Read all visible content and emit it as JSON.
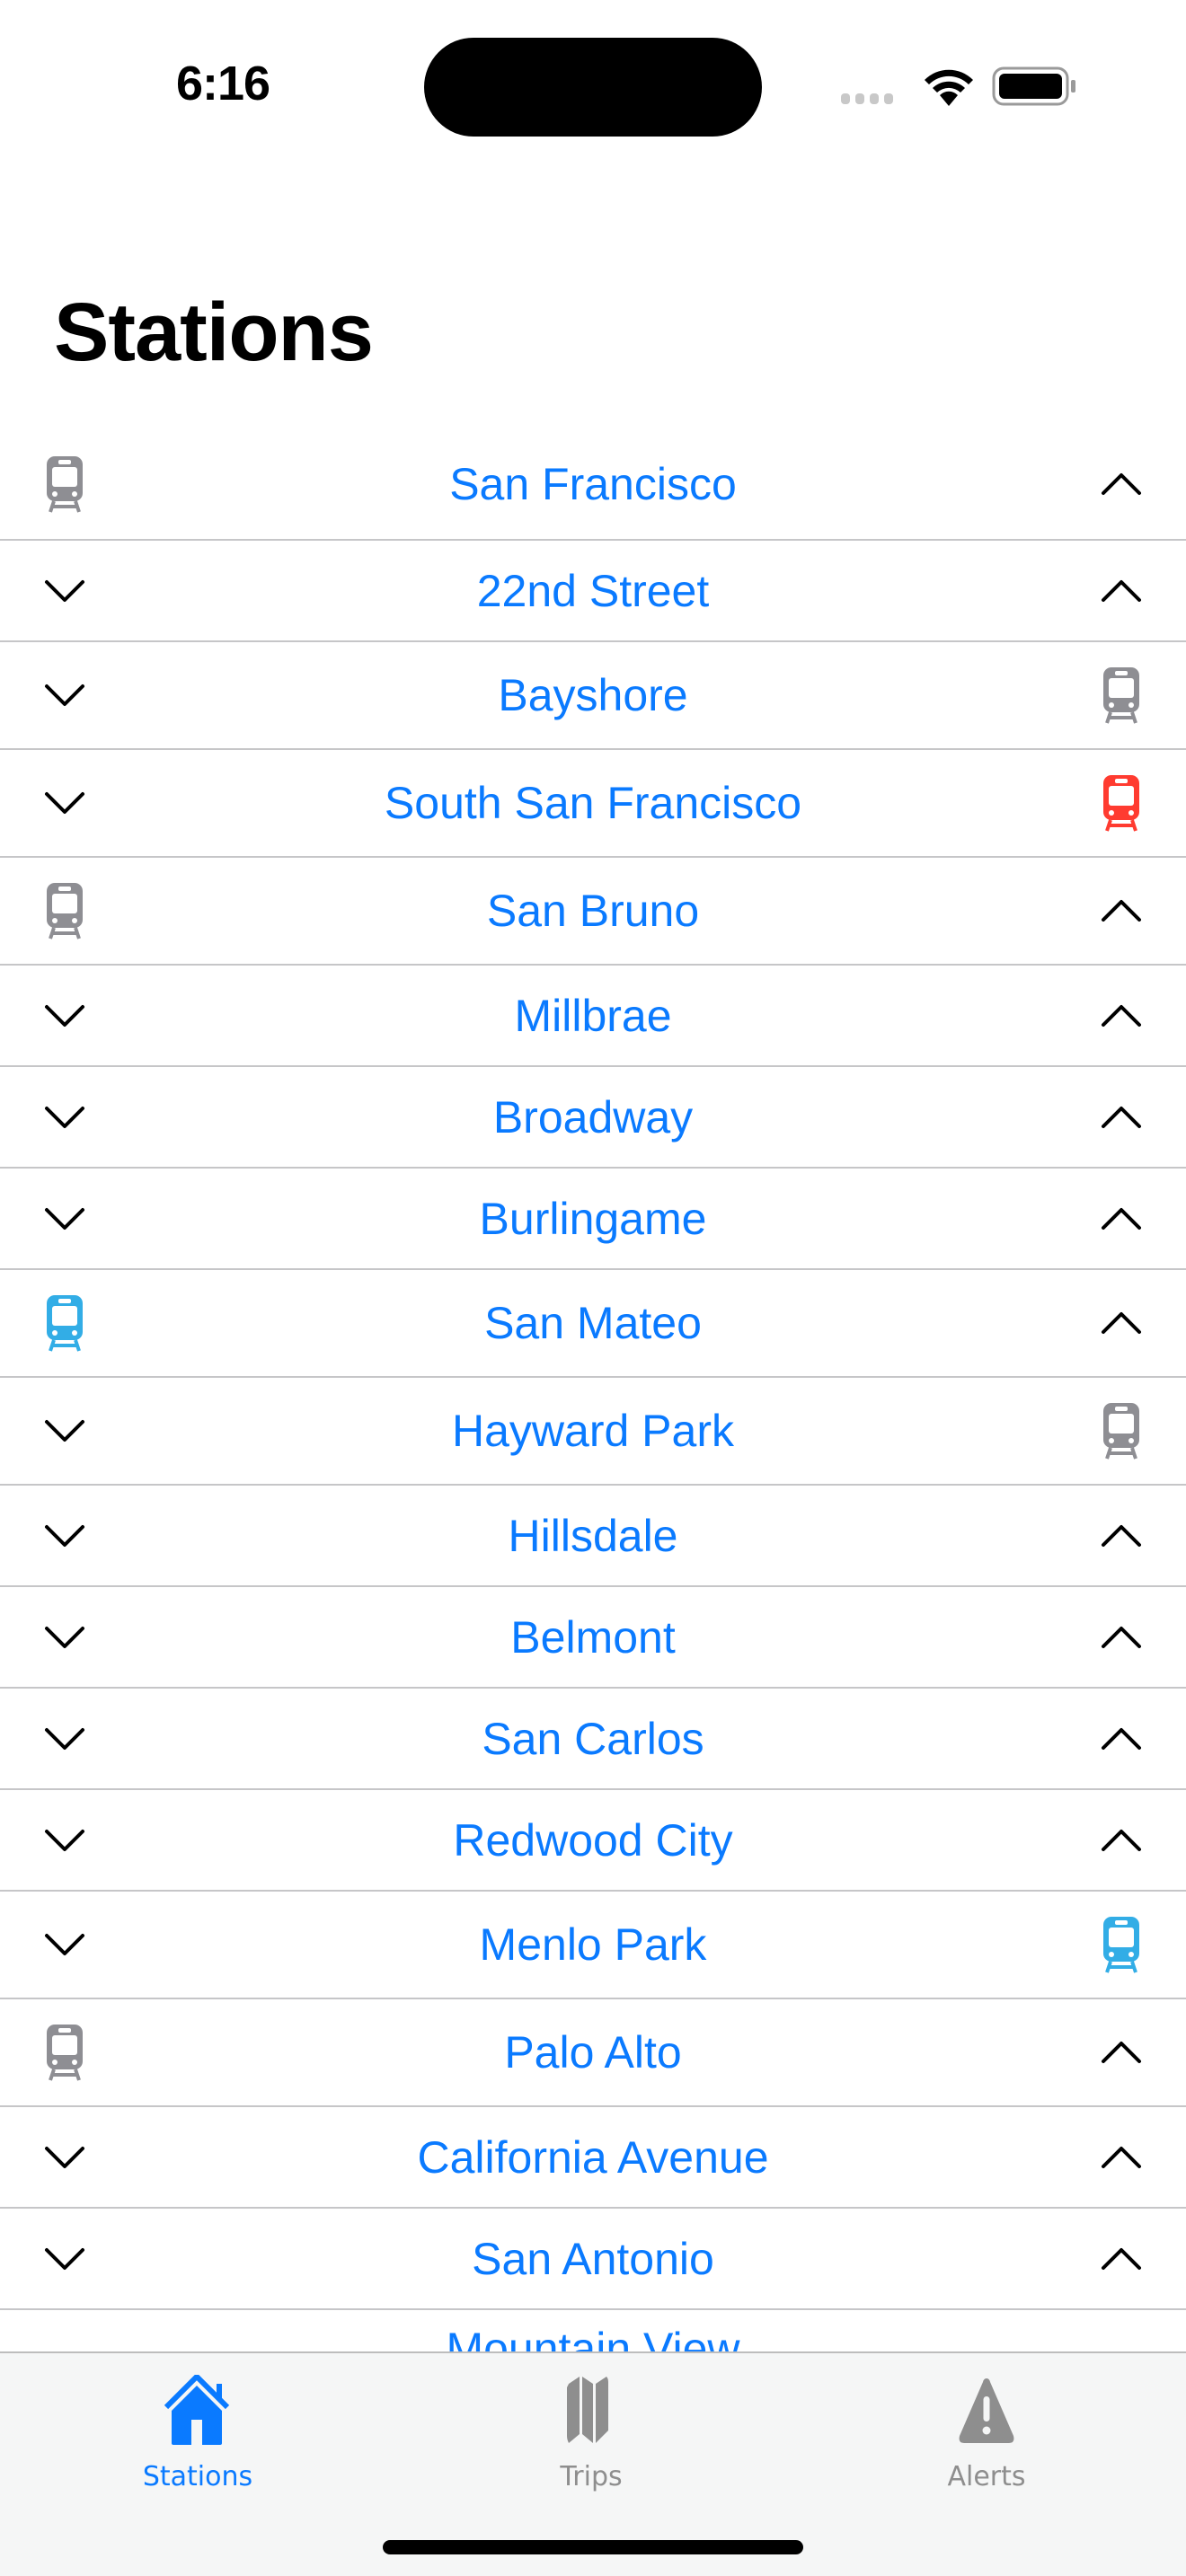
{
  "status_bar": {
    "time": "6:16",
    "icons": [
      "cellular-signal-icon",
      "wifi-icon",
      "battery-icon"
    ]
  },
  "header": {
    "title": "Stations"
  },
  "colors": {
    "accent": "#0a7aff",
    "train_gray": "#8e8e93",
    "train_red": "#ff3b30",
    "train_blue": "#32ade6",
    "separator": "#c6c6c8"
  },
  "stations": [
    {
      "name": "San Francisco",
      "left": "train-gray",
      "right": "chevron-up"
    },
    {
      "name": "22nd Street",
      "left": "chevron-down",
      "right": "chevron-up"
    },
    {
      "name": "Bayshore",
      "left": "chevron-down",
      "right": "train-gray"
    },
    {
      "name": "South San Francisco",
      "left": "chevron-down",
      "right": "train-red"
    },
    {
      "name": "San Bruno",
      "left": "train-gray",
      "right": "chevron-up"
    },
    {
      "name": "Millbrae",
      "left": "chevron-down",
      "right": "chevron-up"
    },
    {
      "name": "Broadway",
      "left": "chevron-down",
      "right": "chevron-up"
    },
    {
      "name": "Burlingame",
      "left": "chevron-down",
      "right": "chevron-up"
    },
    {
      "name": "San Mateo",
      "left": "train-blue",
      "right": "chevron-up"
    },
    {
      "name": "Hayward Park",
      "left": "chevron-down",
      "right": "train-gray"
    },
    {
      "name": "Hillsdale",
      "left": "chevron-down",
      "right": "chevron-up"
    },
    {
      "name": "Belmont",
      "left": "chevron-down",
      "right": "chevron-up"
    },
    {
      "name": "San Carlos",
      "left": "chevron-down",
      "right": "chevron-up"
    },
    {
      "name": "Redwood City",
      "left": "chevron-down",
      "right": "chevron-up"
    },
    {
      "name": "Menlo Park",
      "left": "chevron-down",
      "right": "train-blue"
    },
    {
      "name": "Palo Alto",
      "left": "train-gray",
      "right": "chevron-up"
    },
    {
      "name": "California Avenue",
      "left": "chevron-down",
      "right": "chevron-up"
    },
    {
      "name": "San Antonio",
      "left": "chevron-down",
      "right": "chevron-up"
    }
  ],
  "partial_station": {
    "name": "Mountain View"
  },
  "tab_bar": {
    "tabs": [
      {
        "label": "Stations",
        "icon": "house-icon",
        "active": true
      },
      {
        "label": "Trips",
        "icon": "map-icon",
        "active": false
      },
      {
        "label": "Alerts",
        "icon": "warning-icon",
        "active": false
      }
    ]
  }
}
